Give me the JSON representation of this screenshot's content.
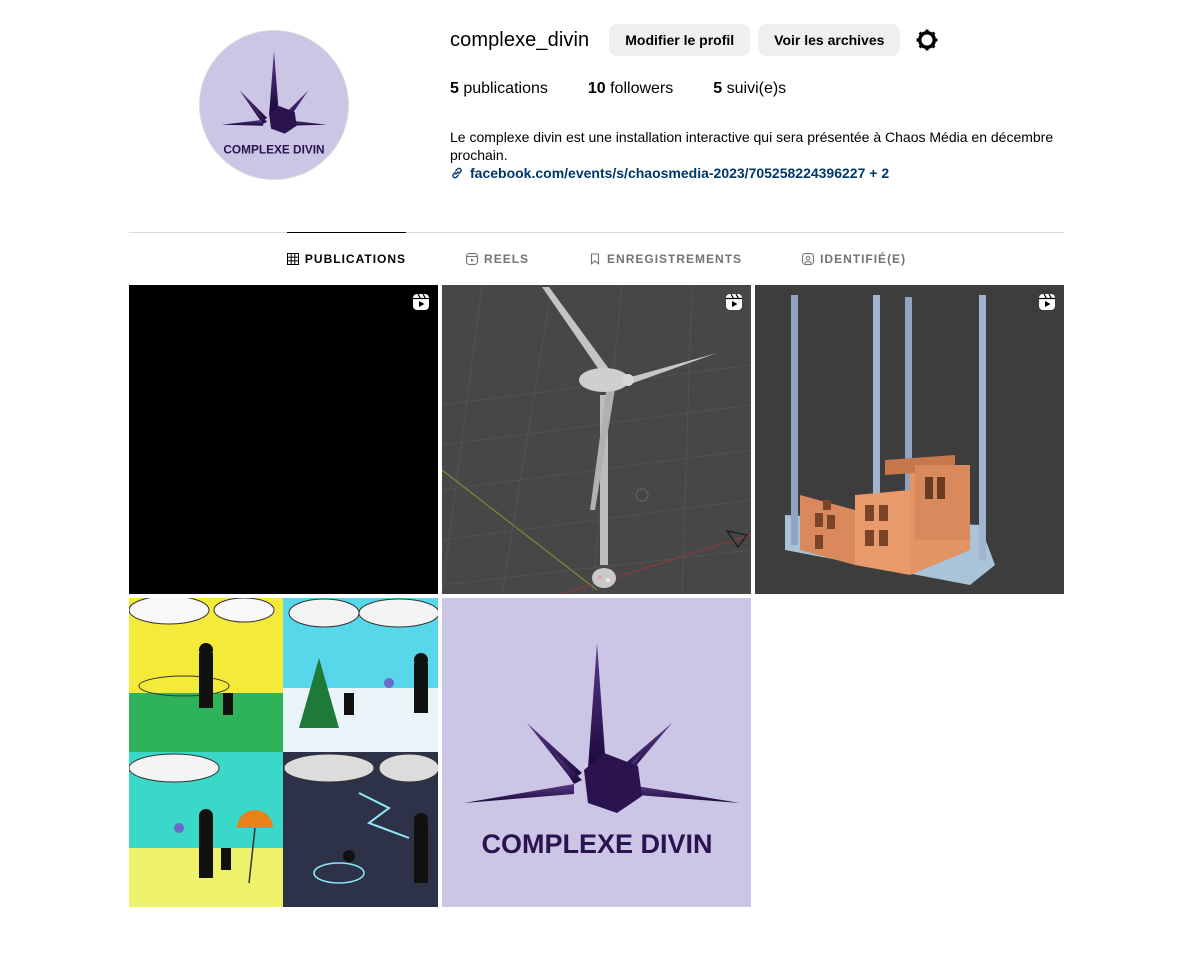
{
  "profile": {
    "username": "complexe_divin",
    "edit_button": "Modifier le profil",
    "archive_button": "Voir les archives",
    "settings_icon": "gear-icon",
    "avatar_text": "COMPLEXE DIVIN",
    "stats": {
      "posts_count": "5",
      "posts_label": "publications",
      "followers_count": "10",
      "followers_label": "followers",
      "following_count": "5",
      "following_label": "suivi(e)s"
    },
    "bio": "Le complexe divin est une installation interactive qui sera présentée à Chaos Média en décembre prochain.",
    "link": "facebook.com/events/s/chaosmedia-2023/705258224396227 + 2"
  },
  "tabs": [
    {
      "label": "PUBLICATIONS",
      "icon": "grid-icon",
      "active": true
    },
    {
      "label": "REELS",
      "icon": "reels-icon",
      "active": false
    },
    {
      "label": "ENREGISTREMENTS",
      "icon": "bookmark-icon",
      "active": false
    },
    {
      "label": "IDENTIFIÉ(E)",
      "icon": "tagged-icon",
      "active": false
    }
  ],
  "posts": [
    {
      "kind": "reel",
      "description": "black"
    },
    {
      "kind": "reel",
      "description": "wind turbine 3d"
    },
    {
      "kind": "reel",
      "description": "building 3d"
    },
    {
      "kind": "image",
      "description": "storyboard"
    },
    {
      "kind": "image",
      "description": "logo"
    }
  ],
  "logo_text": "COMPLEXE DIVIN",
  "colors": {
    "logo_bg": "#ccc6e6",
    "logo_purple": "#2b1350",
    "link": "#00376b",
    "button_bg": "#efefef"
  }
}
